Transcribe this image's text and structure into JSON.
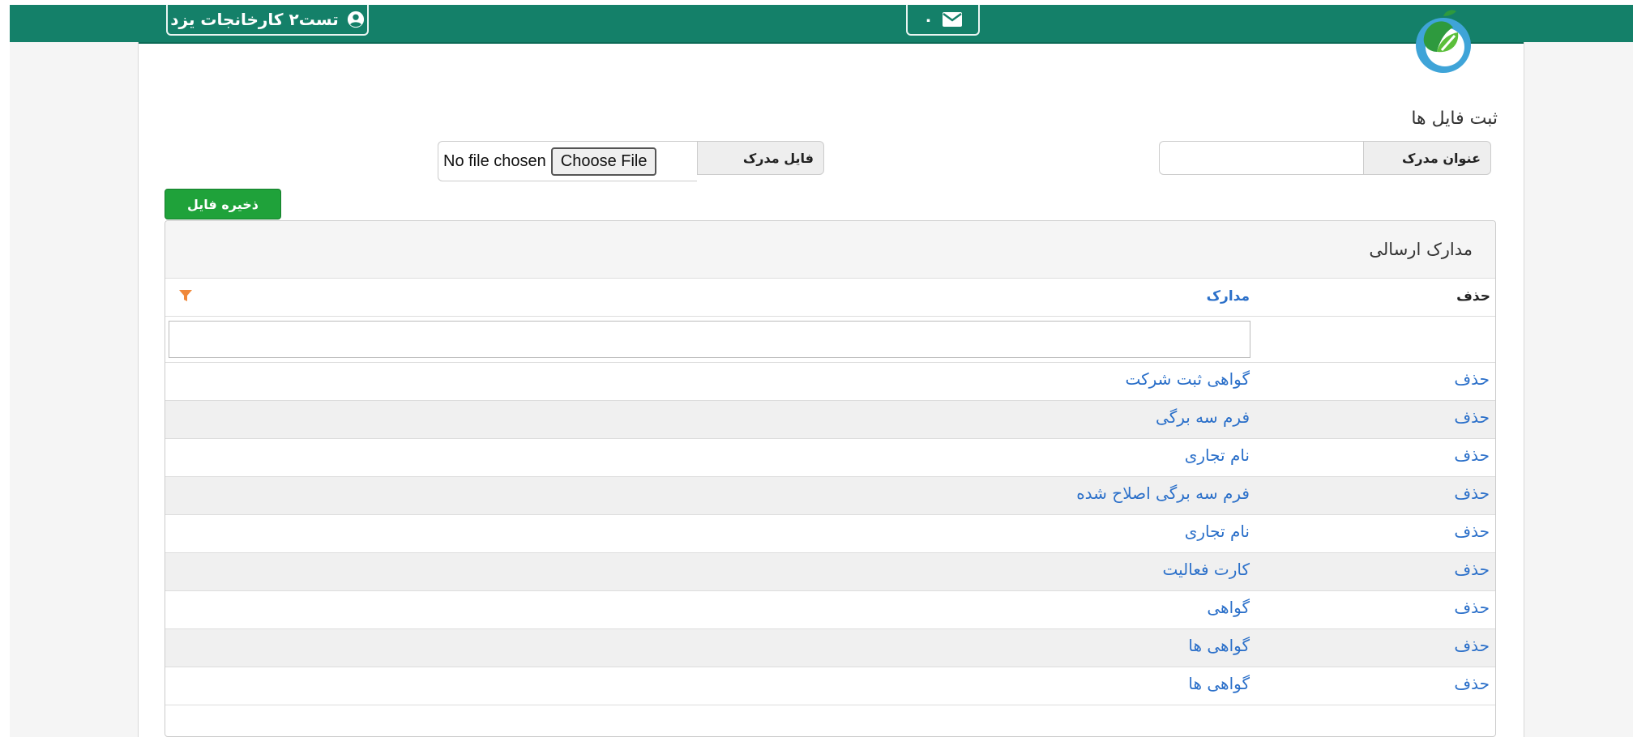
{
  "header": {
    "user_name": "تست۲ کارخانجات یزد",
    "messages_count": "۰",
    "user_icon": "user-circle-icon",
    "mail_icon": "envelope-icon",
    "logo_icon": "apple-logo-icon"
  },
  "form": {
    "section_title": "ثبت فایل ها",
    "doc_title_label": "عنوان مدرک",
    "doc_title_value": "",
    "file_label": "فایل مدرک",
    "file_button": "Choose File",
    "file_status": "No file chosen",
    "save_button": "ذخیره فایل"
  },
  "panel": {
    "title": "مدارک ارسالی",
    "columns": {
      "delete": "حذف",
      "document": "مدارک"
    },
    "filter_value": "",
    "rows": [
      {
        "delete": "حذف",
        "document": "گواهی ثبت شرکت"
      },
      {
        "delete": "حذف",
        "document": "فرم سه برگی"
      },
      {
        "delete": "حذف",
        "document": "نام تجاری"
      },
      {
        "delete": "حذف",
        "document": "فرم سه برگی اصلاح شده"
      },
      {
        "delete": "حذف",
        "document": "نام تجاری"
      },
      {
        "delete": "حذف",
        "document": "کارت فعالیت"
      },
      {
        "delete": "حذف",
        "document": "گواهی"
      },
      {
        "delete": "حذف",
        "document": "گواهی ها"
      },
      {
        "delete": "حذف",
        "document": "گواهی ها"
      }
    ]
  },
  "colors": {
    "header_bg": "#148069",
    "save_button_bg": "#1fa23a",
    "link": "#2a6fc9",
    "filter_icon": "#f0883a"
  }
}
